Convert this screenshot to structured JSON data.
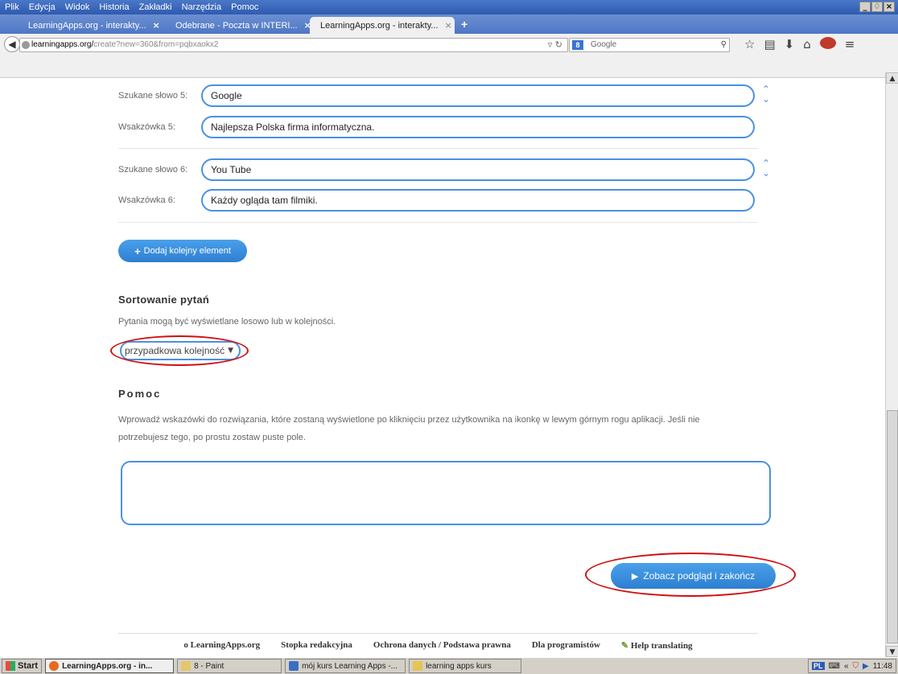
{
  "menubar": {
    "items": [
      "Plik",
      "Edycja",
      "Widok",
      "Historia",
      "Zakładki",
      "Narzędzia",
      "Pomoc"
    ],
    "win": [
      "_",
      "♢",
      "×"
    ]
  },
  "tabs": [
    {
      "label": "LearningApps.org - interakty...",
      "close": "×"
    },
    {
      "label": "Odebrane - Poczta w INTERI...",
      "close": "×"
    },
    {
      "label": "LearningApps.org - interakty...",
      "close": "×"
    }
  ],
  "newtab": "+",
  "nav": {
    "url_host": "learningapps.org/",
    "url_path": "create?new=360&from=pqbxaokx2",
    "search_placeholder": "Google",
    "search_engine": "8"
  },
  "entries": [
    {
      "word_label": "Szukane słowo 5:",
      "word": "Google",
      "hint_label": "Wsakzówka 5:",
      "hint": "Najlepsza Polska firma informatyczna."
    },
    {
      "word_label": "Szukane słowo 6:",
      "word": "You Tube",
      "hint_label": "Wsakzówka 6:",
      "hint": "Każdy ogląda tam filmiki."
    }
  ],
  "add_button": "Dodaj kolejny element",
  "sort": {
    "title": "Sortowanie pytań",
    "desc": "Pytania mogą być wyświetlane losowo lub w kolejności.",
    "selected": "przypadkowa kolejność"
  },
  "help": {
    "title": "Pomoc",
    "desc1": "Wprowadź wskazówki do rozwiązania, które zostaną wyświetlone po kliknięciu przez użytkownika na ikonkę w lewym górnym rogu aplikacji. Jeśli nie",
    "desc2": "potrzebujesz tego, po prostu zostaw puste pole.",
    "value": ""
  },
  "preview_button": "Zobacz podgląd i zakończ",
  "footer": [
    "o LearningApps.org",
    "Stopka redakcyjna",
    "Ochrona danych / Podstawa prawna",
    "Dla programistów",
    "Help translating"
  ],
  "taskbar": {
    "start": "Start",
    "items": [
      "LearningApps.org - in...",
      "8 - Paint",
      "mój kurs Learning Apps -...",
      "learning apps kurs"
    ],
    "lang": "PL",
    "time": "11:48"
  },
  "colors": {
    "accent": "#4a90e2",
    "highlight": "#d01010"
  }
}
